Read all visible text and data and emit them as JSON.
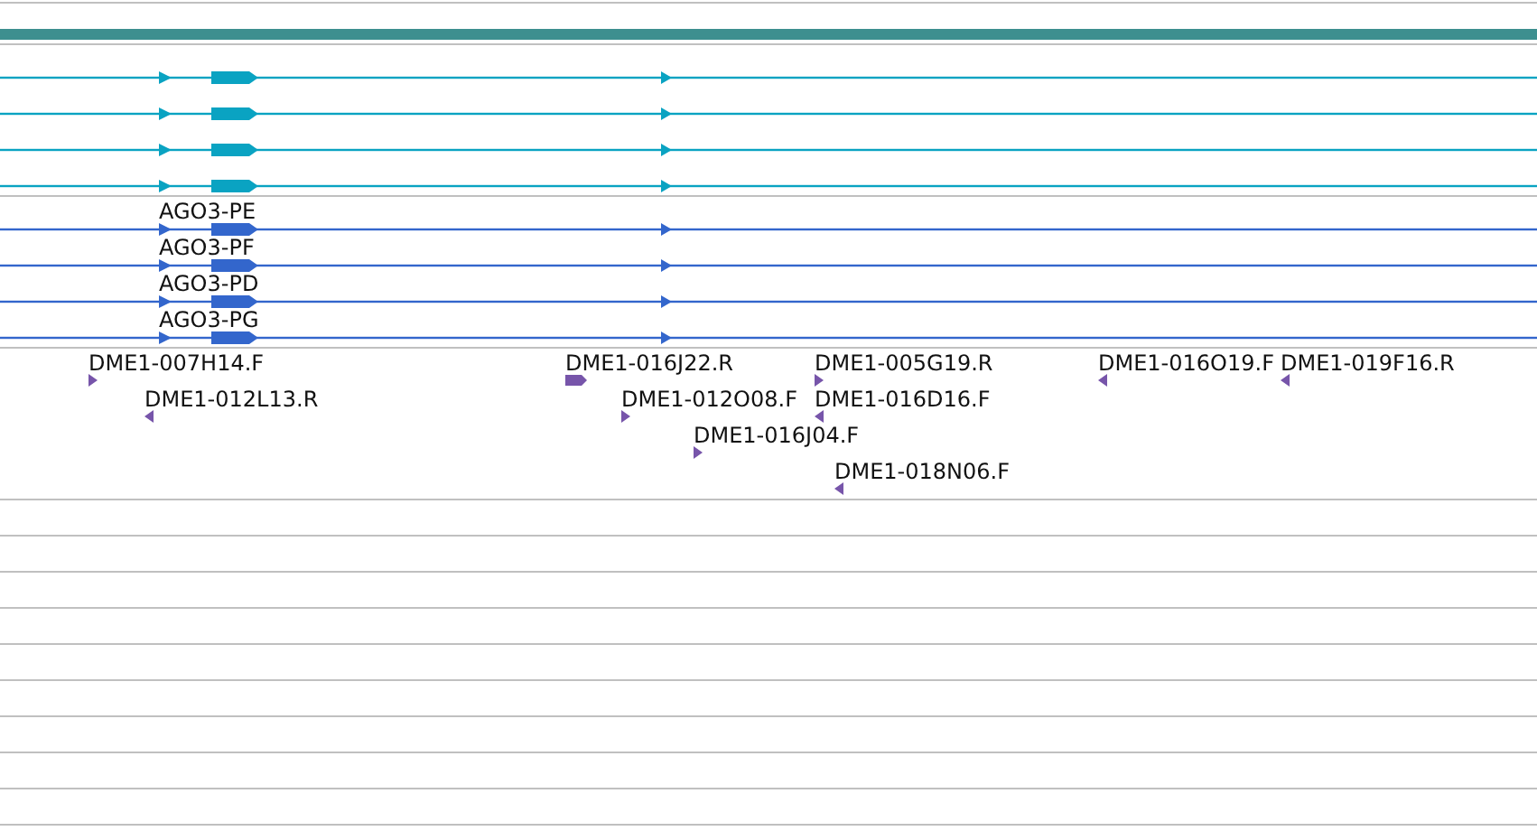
{
  "gene_track": {
    "transcripts": [
      {
        "label": "AGO3-PE"
      },
      {
        "label": "AGO3-PF"
      },
      {
        "label": "AGO3-PD"
      },
      {
        "label": "AGO3-PG"
      }
    ]
  },
  "est_track": {
    "clones": [
      {
        "label": "DME1-007H14.F",
        "reverse": false
      },
      {
        "label": "DME1-016J22.R",
        "reverse": false
      },
      {
        "label": "DME1-005G19.R",
        "reverse": false
      },
      {
        "label": "DME1-016O19.F",
        "reverse": true
      },
      {
        "label": "DME1-019F16.R",
        "reverse": true
      },
      {
        "label": "DME1-012L13.R",
        "reverse": true
      },
      {
        "label": "DME1-012O08.F",
        "reverse": false
      },
      {
        "label": "DME1-016D16.F",
        "reverse": true
      },
      {
        "label": "DME1-016J04.F",
        "reverse": false
      },
      {
        "label": "DME1-018N06.F",
        "reverse": true
      }
    ]
  }
}
